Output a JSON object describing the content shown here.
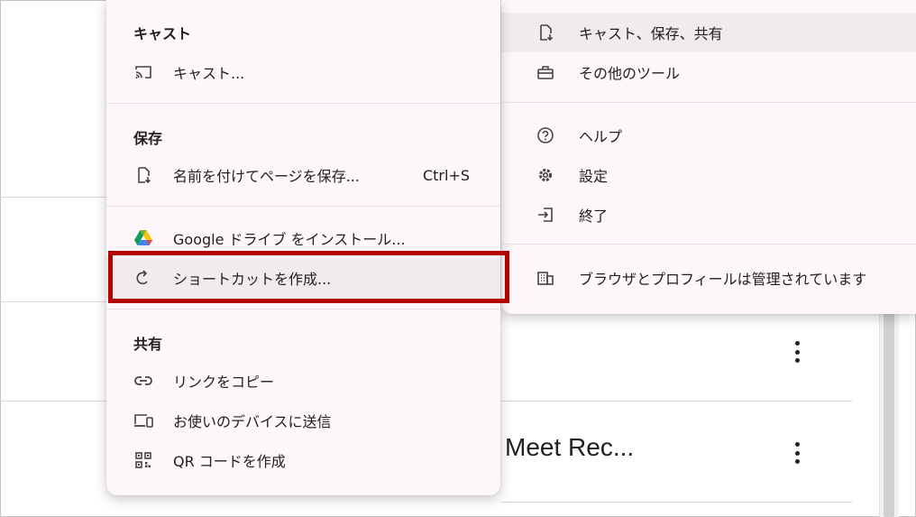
{
  "page": {
    "meet_title": "Meet Rec..."
  },
  "left_menu": {
    "cast_section": {
      "heading": "キャスト",
      "items": [
        {
          "label": "キャスト...",
          "icon": "cast-icon"
        }
      ]
    },
    "save_section": {
      "heading": "保存",
      "items": [
        {
          "label": "名前を付けてページを保存...",
          "shortcut": "Ctrl+S",
          "icon": "save-page-icon"
        }
      ]
    },
    "install_section": {
      "items": [
        {
          "label": "Google ドライブ をインストール...",
          "icon": "google-drive-icon"
        },
        {
          "label": "ショートカットを作成...",
          "icon": "shortcut-icon"
        }
      ]
    },
    "share_section": {
      "heading": "共有",
      "items": [
        {
          "label": "リンクをコピー",
          "icon": "link-icon"
        },
        {
          "label": "お使いのデバイスに送信",
          "icon": "send-to-devices-icon"
        },
        {
          "label": "QR コードを作成",
          "icon": "qr-code-icon"
        }
      ]
    }
  },
  "right_menu": {
    "items": [
      {
        "label": "キャスト、保存、共有",
        "icon": "cast-save-share-icon"
      },
      {
        "label": "その他のツール",
        "icon": "toolbox-icon"
      },
      {
        "label": "ヘルプ",
        "icon": "help-icon"
      },
      {
        "label": "設定",
        "icon": "settings-gear-icon"
      },
      {
        "label": "終了",
        "icon": "exit-icon"
      },
      {
        "label": "ブラウザとプロフィールは管理されています",
        "icon": "managed-building-icon"
      }
    ]
  },
  "colors": {
    "menu_bg": "#fdf7fb",
    "hover_bg": "#f0ebee",
    "highlight_border": "#b50000",
    "text": "#1f1f1f"
  }
}
